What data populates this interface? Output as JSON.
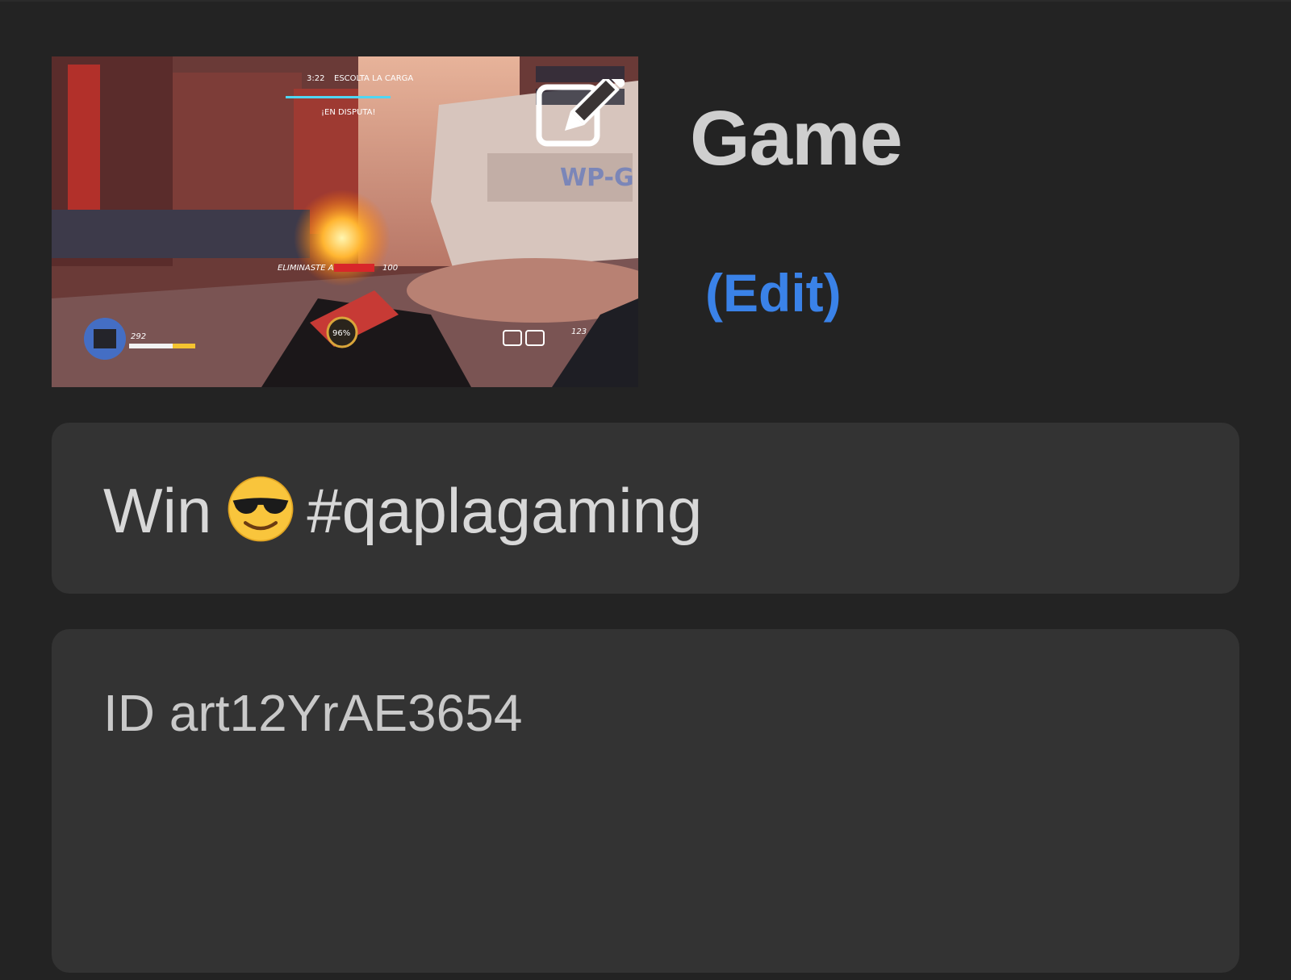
{
  "post": {
    "title": "Game",
    "edit_label": "(Edit)",
    "caption": {
      "before_emoji": "Win",
      "emoji": "smiling-face-with-sunglasses-emoji",
      "after_emoji": "#qaplagaming"
    },
    "description": "ID art12YrAE3654"
  },
  "thumbnail": {
    "hud": {
      "timer": "3:22",
      "objective": "ESCOLTA LA CARGA",
      "status": "¡EN DISPUTA!",
      "kill_feed": "ELIMINASTE A",
      "kill_points": "100",
      "health": "292",
      "ultimate": "96%",
      "ammo": "123"
    },
    "icon": "edit-pencil-icon"
  },
  "colors": {
    "background": "#232323",
    "panel": "#333333",
    "title_text": "#cfcfcf",
    "link": "#3a82e8"
  }
}
